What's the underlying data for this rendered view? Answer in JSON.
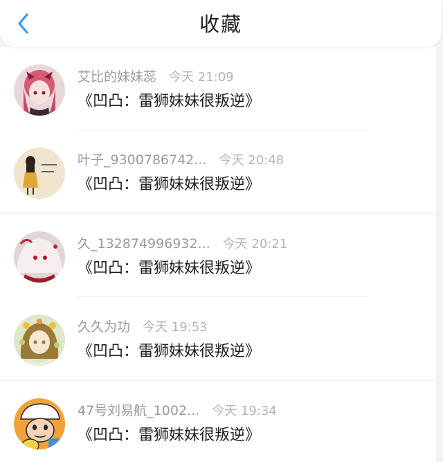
{
  "header": {
    "title": "收藏",
    "back_icon": "chevron-left-icon",
    "accent_color": "#3a9bf0"
  },
  "items": [
    {
      "username": "艾比的妹妹蕊",
      "time": "今天 21:09",
      "title": "《凹凸：雷狮妹妹很叛逆》",
      "avatar_icon": "avatar-anime-pink-hair"
    },
    {
      "username": "叶子_9300786742...",
      "time": "今天 20:48",
      "title": "《凹凸：雷狮妹妹很叛逆》",
      "avatar_icon": "avatar-drawn-girl-yellow-dress"
    },
    {
      "username": "久_132874996932...",
      "time": "今天 20:21",
      "title": "《凹凸：雷狮妹妹很叛逆》",
      "avatar_icon": "avatar-anime-white-hair-red"
    },
    {
      "username": "久久为功",
      "time": "今天 19:53",
      "title": "《凹凸：雷狮妹妹很叛逆》",
      "avatar_icon": "avatar-anime-girl-flowers"
    },
    {
      "username": "47号刘易航_1002...",
      "time": "今天 19:34",
      "title": "《凹凸：雷狮妹妹很叛逆》",
      "avatar_icon": "avatar-cartoon-boy"
    }
  ]
}
